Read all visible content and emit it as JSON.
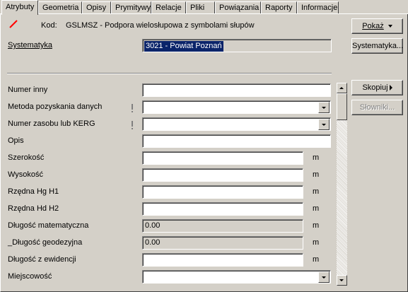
{
  "tabs": [
    "Atrybuty",
    "Geometria",
    "Opisy",
    "Prymitywy",
    "Relacje",
    "Pliki",
    "Powiązania",
    "Raporty",
    "Informacje"
  ],
  "header": {
    "kod_label": "Kod:",
    "kod_value": "GSLMSZ - Podpora wielosłupowa z symbolami słupów",
    "systematyka_label": "Systematyka",
    "systematyka_value": "3021 - Powiat Poznań",
    "line_color": "#ff0000"
  },
  "buttons": {
    "pokaz": "Pokaż",
    "systematyka": "Systematyka...",
    "skopiuj": "Skopiuj",
    "slowniki": "Słowniki..."
  },
  "fields": [
    {
      "label": "Numer inny",
      "value": ""
    },
    {
      "label": "Metoda pozyskania danych",
      "value": ""
    },
    {
      "label": "Numer zasobu lub KERG",
      "value": ""
    },
    {
      "label": "Opis",
      "value": ""
    },
    {
      "label": "Szerokość",
      "value": "",
      "unit": "m"
    },
    {
      "label": "Wysokość",
      "value": "",
      "unit": "m"
    },
    {
      "label": "Rzędna Hg H1",
      "value": "",
      "unit": "m"
    },
    {
      "label": "Rzędna Hd H2",
      "value": "",
      "unit": "m"
    },
    {
      "label": "Długość matematyczna",
      "value": "0.00",
      "unit": "m"
    },
    {
      "label": "_Długość geodezyjna",
      "value": "0.00",
      "unit": "m"
    },
    {
      "label": "Długość z ewidencji",
      "value": "",
      "unit": "m"
    },
    {
      "label": "Miejscowość",
      "value": ""
    }
  ]
}
